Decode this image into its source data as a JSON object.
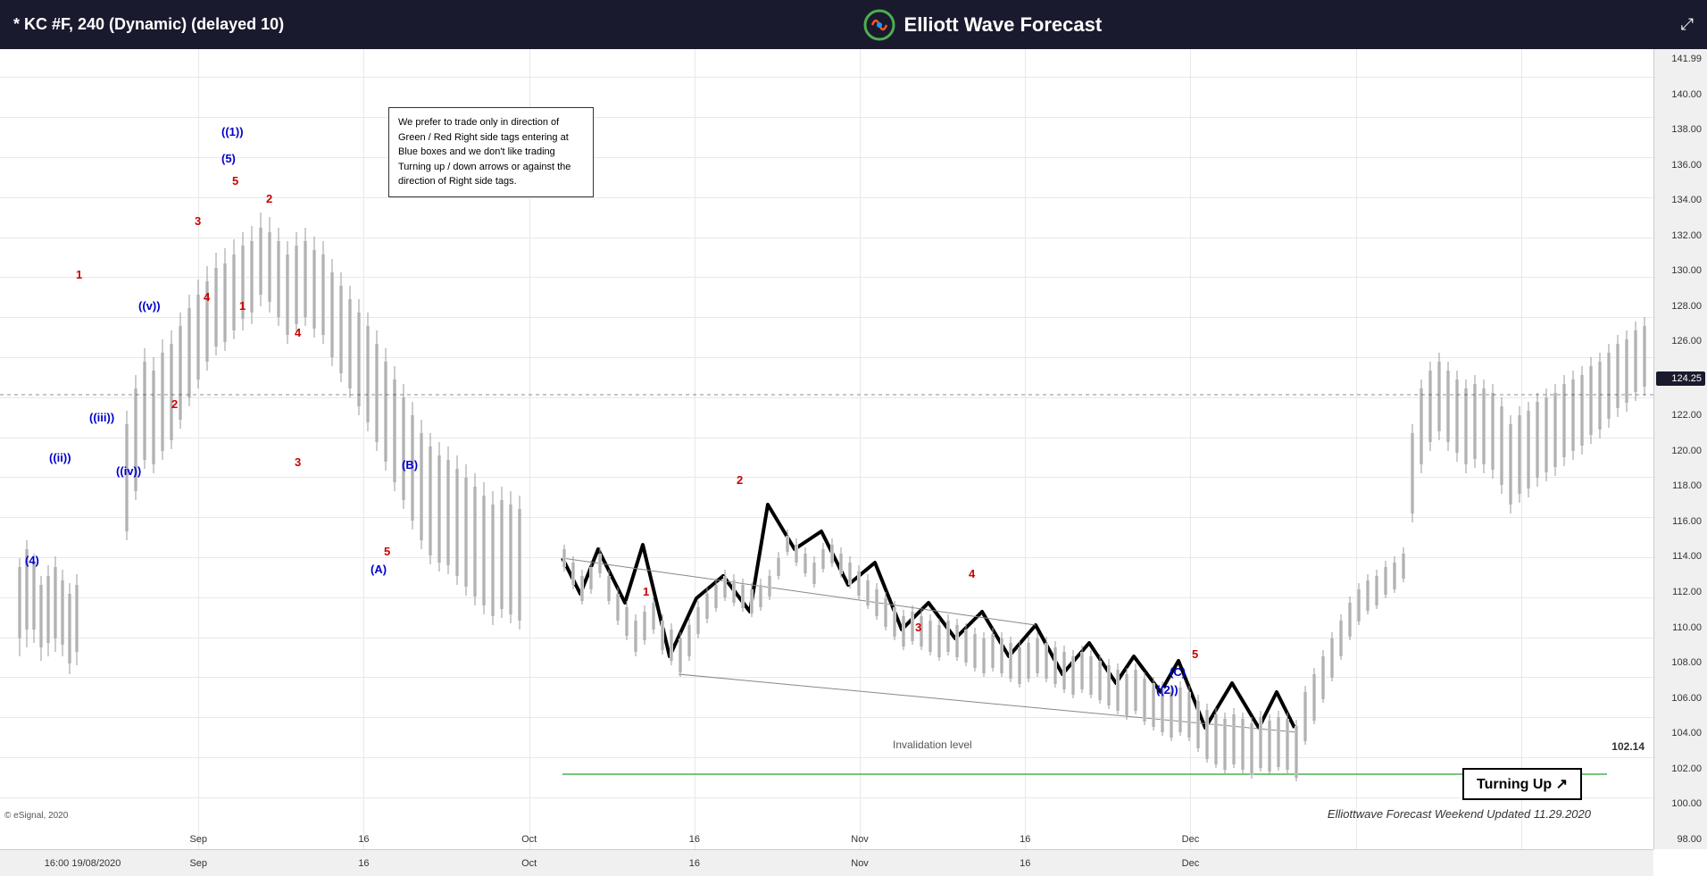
{
  "header": {
    "title": "* KC #F, 240 (Dynamic) (delayed 10)",
    "brand": "Elliott Wave Forecast",
    "expand_icon": "⤢"
  },
  "priceAxis": {
    "current": "124.25",
    "labels": [
      "141.99",
      "140.00",
      "138.00",
      "136.00",
      "134.00",
      "132.00",
      "130.00",
      "128.00",
      "126.00",
      "122.00",
      "120.00",
      "118.00",
      "116.00",
      "114.00",
      "112.00",
      "110.00",
      "108.00",
      "106.00",
      "104.00",
      "102.00",
      "100.00",
      "98.00"
    ]
  },
  "timeAxis": {
    "labels": [
      "Sep",
      "16",
      "Oct",
      "16",
      "Nov",
      "16",
      "Dec"
    ],
    "bottomLabels": [
      "16:00 19/08/2020",
      "Sep",
      "16",
      "Oct",
      "16",
      "Nov",
      "16",
      "Dec"
    ]
  },
  "waveLabels": {
    "label_4": "(4)",
    "label_ii": "((ii))",
    "label_1": "1",
    "label_iii": "((iii))",
    "label_iv": "((iv))",
    "label_v": "((v))",
    "label_2_left": "2",
    "label_3": "3",
    "label_4b": "4",
    "label_5_blue": "(5)",
    "label_5_red": "5",
    "label_1paren": "((1))",
    "label_2b": "2",
    "label_1c": "1",
    "label_4c": "4",
    "label_3c": "3",
    "label_B": "(B)",
    "label_5oct": "5",
    "label_A": "(A)",
    "label_1oct": "1",
    "label_2oct": "2",
    "label_4oct": "4",
    "label_3oct": "3",
    "label_5nov": "5",
    "label_C": "(C)",
    "label_2paren": "((2))"
  },
  "annotation": {
    "text": "We prefer to trade only in direction of Green / Red Right side tags entering at Blue boxes and we don't like trading Turning up / down arrows or against the direction of Right side tags."
  },
  "invalidation": {
    "label": "Invalidation level",
    "price": "102.14"
  },
  "badge": {
    "text": "Turning Up"
  },
  "footer": {
    "copyright": "© eSignal, 2020",
    "updated": "Elliottwave Forecast Weekend Updated 11.29.2020"
  }
}
